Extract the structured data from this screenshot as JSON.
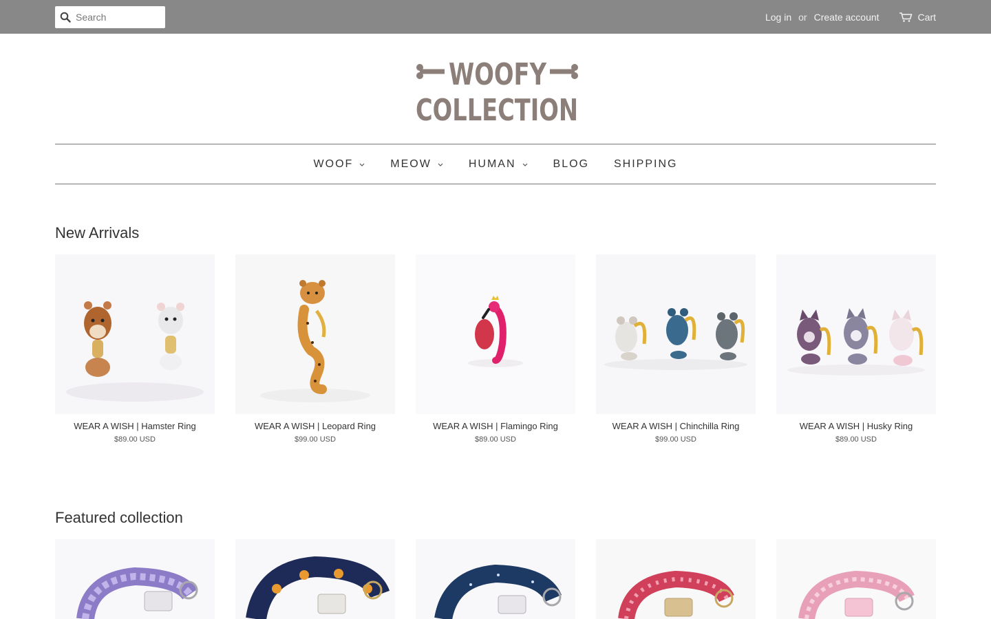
{
  "header": {
    "search_placeholder": "Search",
    "login": "Log in",
    "or": "or",
    "create_account": "Create account",
    "cart": "Cart"
  },
  "logo": {
    "line1": "WOOFY",
    "line2": "COLLECTION",
    "color": "#8c7f7a"
  },
  "nav": {
    "items": [
      {
        "label": "WOOF",
        "dropdown": true
      },
      {
        "label": "MEOW",
        "dropdown": true
      },
      {
        "label": "HUMAN",
        "dropdown": true
      },
      {
        "label": "BLOG",
        "dropdown": false
      },
      {
        "label": "SHIPPING",
        "dropdown": false
      }
    ]
  },
  "new_arrivals": {
    "title": "New Arrivals",
    "products": [
      {
        "name": "WEAR A WISH | Hamster Ring",
        "price": "$89.00 USD"
      },
      {
        "name": "WEAR A WISH | Leopard Ring",
        "price": "$99.00 USD"
      },
      {
        "name": "WEAR A WISH | Flamingo Ring",
        "price": "$89.00 USD"
      },
      {
        "name": "WEAR A WISH | Chinchilla Ring",
        "price": "$99.00 USD"
      },
      {
        "name": "WEAR A WISH | Husky Ring",
        "price": "$89.00 USD"
      }
    ]
  },
  "featured": {
    "title": "Featured collection"
  },
  "colors": {
    "topbar": "#888888",
    "text": "#333333"
  }
}
